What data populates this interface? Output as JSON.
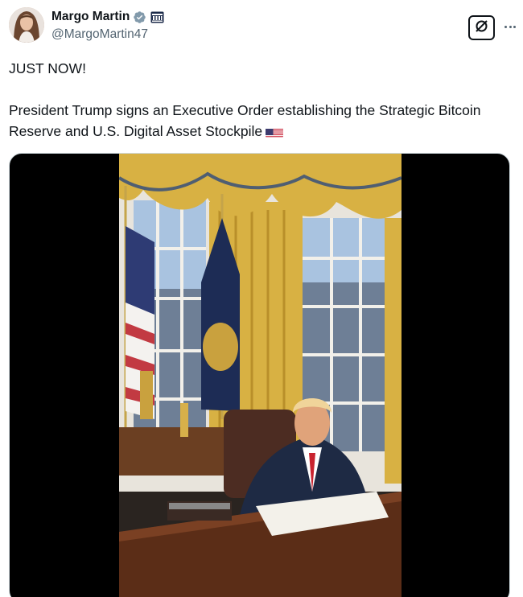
{
  "author": {
    "display_name": "Margo Martin",
    "handle": "@MargoMartin47"
  },
  "icons": {
    "verified": "verified-badge-icon",
    "affiliate": "affiliate-badge-icon",
    "grok": "grok-icon",
    "more": "more-options-icon",
    "flag": "us-flag-emoji"
  },
  "tweet": {
    "line1": "JUST NOW!",
    "line2": "President Trump signs an Executive Order establishing the Strategic Bitcoin Reserve and U.S. Digital Asset Stockpile"
  },
  "colors": {
    "text": "#0f1419",
    "secondary_text": "#536471",
    "verified_blue": "#829aab",
    "curtain_gold": "#d8b143",
    "media_background": "#000000"
  }
}
